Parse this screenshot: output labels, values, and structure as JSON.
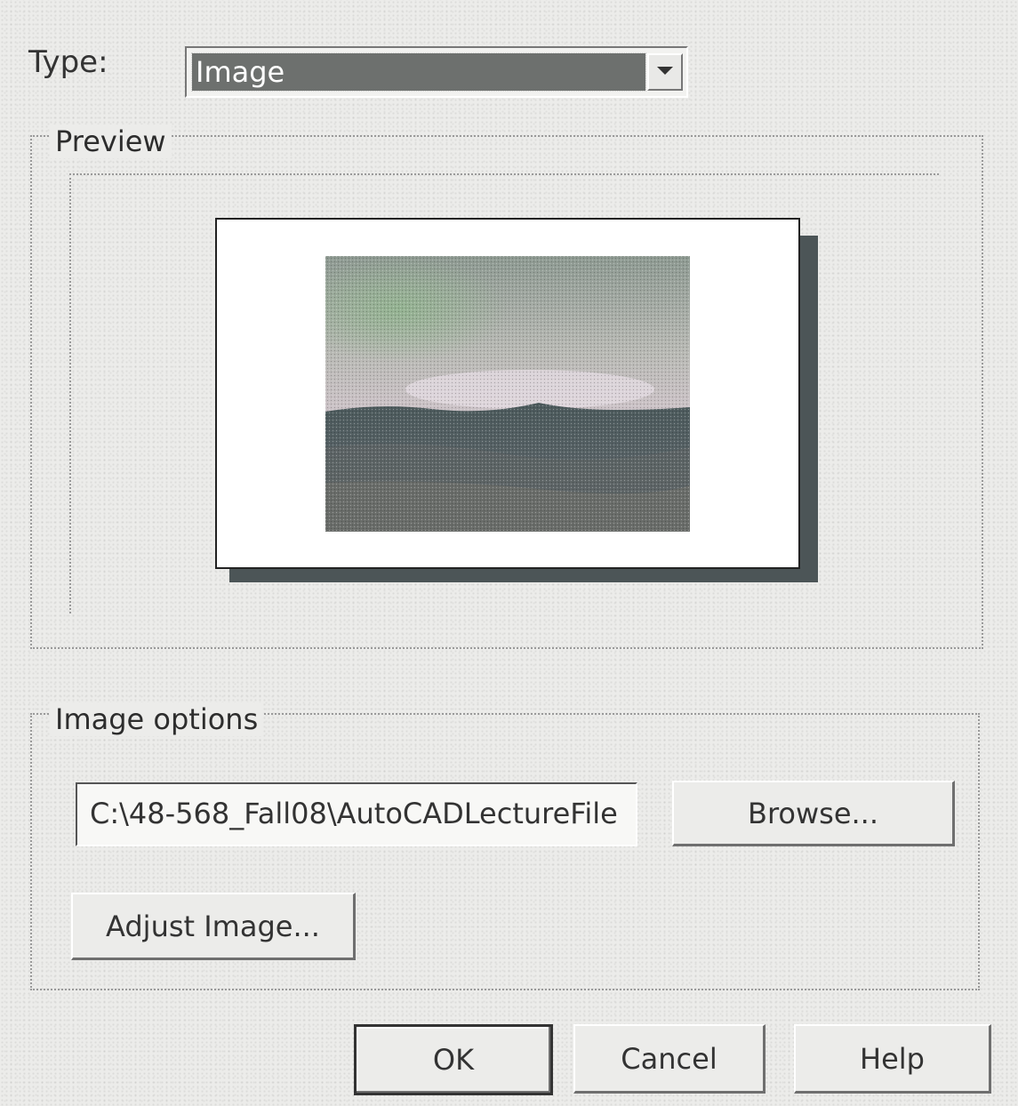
{
  "type_row": {
    "label": "Type:",
    "selected": "Image",
    "dropdown_icon": "chevron-down-icon"
  },
  "preview": {
    "group_title": "Preview",
    "image_description_icon": "landscape-photo"
  },
  "image_options": {
    "group_title": "Image options",
    "path_value": "C:\\48-568_Fall08\\AutoCADLectureFile",
    "browse_label": "Browse...",
    "adjust_label": "Adjust Image..."
  },
  "dialog_buttons": {
    "ok": "OK",
    "cancel": "Cancel",
    "help": "Help"
  }
}
